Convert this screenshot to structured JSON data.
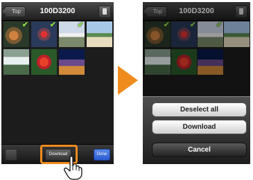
{
  "left_screen": {
    "nav": {
      "back_label": "Top",
      "title": "100D3200",
      "device_icon": "phone-icon"
    },
    "thumbnails": [
      {
        "checked": true
      },
      {
        "checked": true
      },
      {
        "checked": true
      },
      {
        "checked": false
      },
      {
        "checked": false
      },
      {
        "checked": false
      },
      {
        "checked": false
      }
    ],
    "toolbar": {
      "download_label": "Download",
      "done_label": "Done"
    }
  },
  "right_screen": {
    "nav": {
      "back_label": "Top",
      "title": "100D3200",
      "device_icon": "phone-icon"
    },
    "sheet": {
      "deselect_label": "Deselect all",
      "download_label": "Download",
      "cancel_label": "Cancel"
    }
  },
  "colors": {
    "accent": "#f08c1e",
    "check": "#8fe04a",
    "done_button": "#2a5ad0"
  },
  "check_glyph": "✔"
}
